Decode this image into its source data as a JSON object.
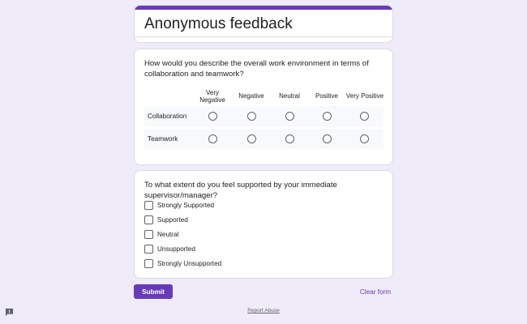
{
  "form": {
    "title": "Anonymous feedback"
  },
  "question1": {
    "text": "How would you describe the overall work environment in terms of collaboration and teamwork?",
    "columns": [
      "Very Negative",
      "Negative",
      "Neutral",
      "Positive",
      "Very Positive"
    ],
    "rows": [
      "Collaboration",
      "Teamwork"
    ]
  },
  "question2": {
    "text": "To what extent do you feel supported by your immediate supervisor/manager?",
    "options": [
      "Strongly Supported",
      "Supported",
      "Neutral",
      "Unsupported",
      "Strongly Unsupported"
    ]
  },
  "actions": {
    "submit_label": "Submit",
    "clear_label": "Clear form"
  },
  "footer": {
    "report_label": "Report Abuse"
  },
  "icons": {
    "feedback": "feedback-icon",
    "radio": "radio-button-icon",
    "checkbox": "checkbox-icon"
  },
  "colors": {
    "accent": "#673ab7",
    "background": "#f0ebf8"
  }
}
